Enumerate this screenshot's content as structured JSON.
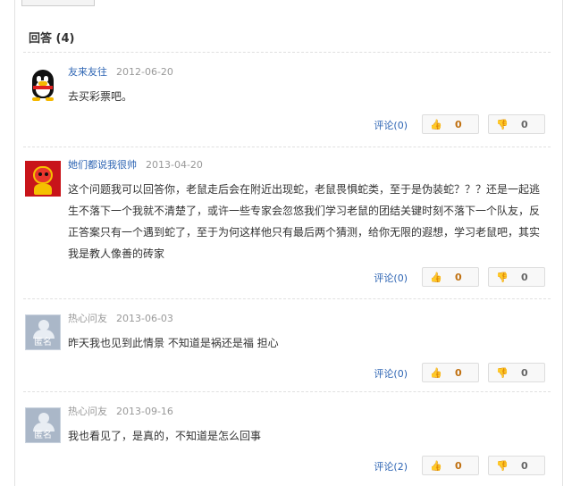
{
  "section": {
    "title": "回答 (4)"
  },
  "answers": [
    {
      "author": "友来友往",
      "date": "2012-06-20",
      "avatar": "qq-penguin-avatar",
      "content": "去买彩票吧。",
      "comment_label": "评论(0)",
      "up_count": "0",
      "down_count": "0"
    },
    {
      "author": "她们都说我很帅",
      "date": "2013-04-20",
      "avatar": "red-lucky-avatar",
      "content": "这个问题我可以回答你，老鼠走后会在附近出现蛇，老鼠畏惧蛇类，至于是伪装蛇？？？还是一起逃生不落下一个我就不清楚了，或许一些专家会忽悠我们学习老鼠的团结关键时刻不落下一个队友，反正答案只有一个遇到蛇了，至于为何这样他只有最后两个猜测，给你无限的遐想，学习老鼠吧，其实我是教人像善的砖家",
      "comment_label": "评论(0)",
      "up_count": "0",
      "down_count": "0"
    },
    {
      "author": "热心问友",
      "date": "2013-06-03",
      "avatar": "anonymous-avatar",
      "avatar_label": "匿名",
      "content": "昨天我也见到此情景 不知道是祸还是福 担心",
      "comment_label": "评论(0)",
      "up_count": "0",
      "down_count": "0"
    },
    {
      "author": "热心问友",
      "date": "2013-09-16",
      "avatar": "anonymous-avatar",
      "avatar_label": "匿名",
      "content": "我也看见了，是真的，不知道是怎么回事",
      "comment_label": "评论(2)",
      "up_count": "0",
      "down_count": "0"
    }
  ],
  "icons": {
    "up": "thumbs-up-icon",
    "down": "thumbs-down-icon"
  },
  "colors": {
    "link": "#2d64b3",
    "meta": "#999999",
    "up": "#d48a1a"
  }
}
